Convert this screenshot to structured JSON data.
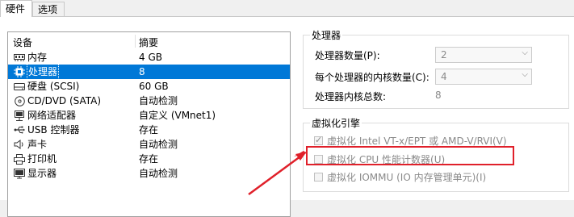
{
  "tabs": [
    {
      "label": "硬件",
      "active": true
    },
    {
      "label": "选项",
      "active": false
    }
  ],
  "device_list": {
    "columns": [
      "设备",
      "摘要"
    ],
    "rows": [
      {
        "icon": "memory-icon",
        "name": "内存",
        "summary": "4 GB",
        "selected": false
      },
      {
        "icon": "processor-icon",
        "name": "处理器",
        "summary": "8",
        "selected": true
      },
      {
        "icon": "hard-disk-icon",
        "name": "硬盘 (SCSI)",
        "summary": "60 GB",
        "selected": false
      },
      {
        "icon": "cd-dvd-icon",
        "name": "CD/DVD (SATA)",
        "summary": "自动检测",
        "selected": false
      },
      {
        "icon": "network-adapter-icon",
        "name": "网络适配器",
        "summary": "自定义 (VMnet1)",
        "selected": false
      },
      {
        "icon": "usb-icon",
        "name": "USB 控制器",
        "summary": "存在",
        "selected": false
      },
      {
        "icon": "sound-card-icon",
        "name": "声卡",
        "summary": "自动检测",
        "selected": false
      },
      {
        "icon": "printer-icon",
        "name": "打印机",
        "summary": "存在",
        "selected": false
      },
      {
        "icon": "display-icon",
        "name": "显示器",
        "summary": "自动检测",
        "selected": false
      }
    ]
  },
  "processor_group": {
    "title": "处理器",
    "count_label": "处理器数量(P):",
    "count_value": "2",
    "cores_label": "每个处理器的内核数量(C):",
    "cores_value": "4",
    "total_label": "处理器内核总数:",
    "total_value": "8"
  },
  "virtualization_group": {
    "title": "虚拟化引擎",
    "options": [
      {
        "label": "虚拟化 Intel VT-x/EPT 或 AMD-V/RVI(V)",
        "checked": true
      },
      {
        "label": "虚拟化 CPU 性能计数器(U)",
        "checked": false
      },
      {
        "label": "虚拟化 IOMMU (IO 内存管理单元)(I)",
        "checked": false
      }
    ]
  },
  "colors": {
    "selection": "#0078d7",
    "highlight_box": "#e0202a"
  }
}
